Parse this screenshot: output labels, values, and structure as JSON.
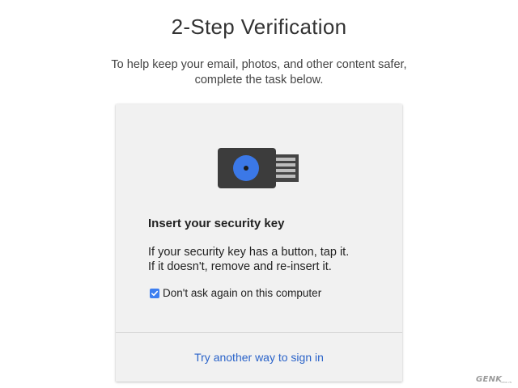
{
  "page": {
    "title": "2-Step Verification",
    "subtitle_line1": "To help keep your email, photos, and other content safer,",
    "subtitle_line2": "complete the task below."
  },
  "card": {
    "illustration": "security-key-icon",
    "heading": "Insert your security key",
    "instruction_line1": "If your security key has a button, tap it.",
    "instruction_line2": "If it doesn't, remove and re-insert it.",
    "checkbox": {
      "label": "Don't ask again on this computer",
      "checked": true
    },
    "alt_link": "Try another way to sign in"
  },
  "watermark": {
    "text": "GENK",
    "sub": "GENK.VN"
  },
  "colors": {
    "accent": "#3c7ef0",
    "link": "#2a63c9",
    "key_body": "#3c3c3c",
    "key_button": "#3b78e7",
    "card_bg": "#f1f1f1"
  }
}
